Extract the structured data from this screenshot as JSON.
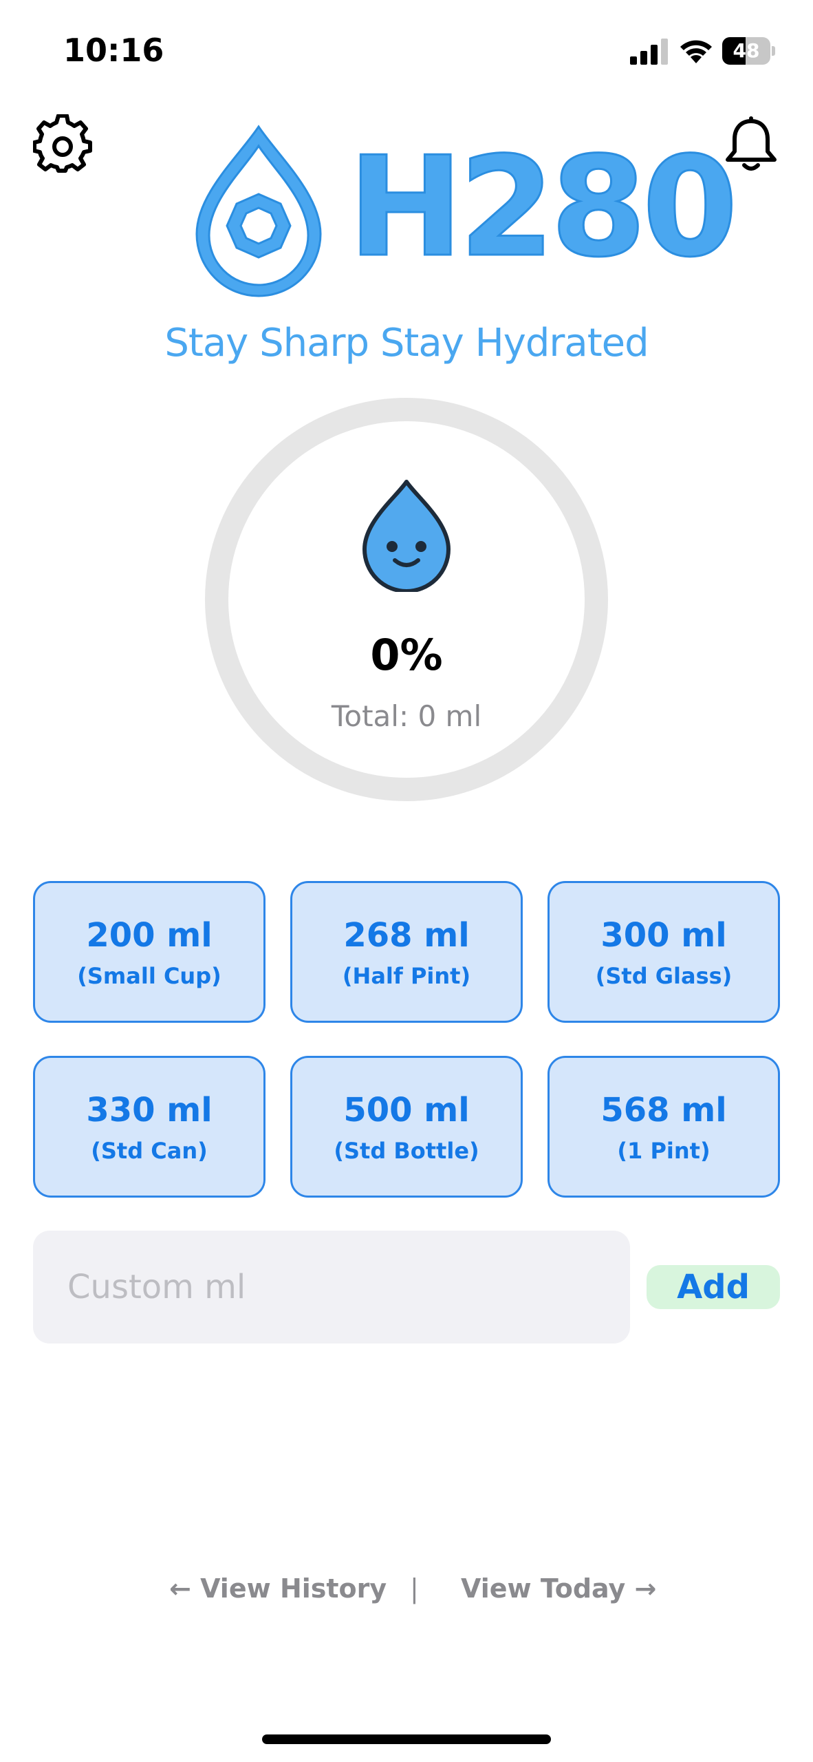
{
  "status_bar": {
    "time": "10:16",
    "battery_level": "48",
    "battery_fraction": 0.48,
    "signal_icon": "cellular-signal-icon",
    "wifi_icon": "wifi-icon"
  },
  "header": {
    "settings_icon": "gear-icon",
    "notifications_icon": "bell-icon",
    "logo_text": "H280",
    "tagline": "Stay Sharp Stay Hydrated"
  },
  "progress": {
    "fraction": 0,
    "percent_label": "0%",
    "total_label": "Total: 0 ml",
    "mascot_icon": "smiling-water-drop-icon"
  },
  "presets": [
    {
      "amount": "200 ml",
      "desc": "(Small Cup)"
    },
    {
      "amount": "268 ml",
      "desc": "(Half Pint)"
    },
    {
      "amount": "300 ml",
      "desc": "(Std Glass)"
    },
    {
      "amount": "330 ml",
      "desc": "(Std Can)"
    },
    {
      "amount": "500 ml",
      "desc": "(Std Bottle)"
    },
    {
      "amount": "568 ml",
      "desc": "(1 Pint)"
    }
  ],
  "custom": {
    "placeholder": "Custom ml",
    "value": "",
    "add_label": "Add"
  },
  "footer": {
    "history_label": "← View History",
    "separator": "|",
    "today_label": "View Today →"
  },
  "colors": {
    "brand_blue": "#4aa7f0",
    "button_blue": "#1478e6",
    "preset_bg": "#d5e6fb",
    "add_bg": "#d8f5dd",
    "ring_track": "#e6e6e6"
  }
}
